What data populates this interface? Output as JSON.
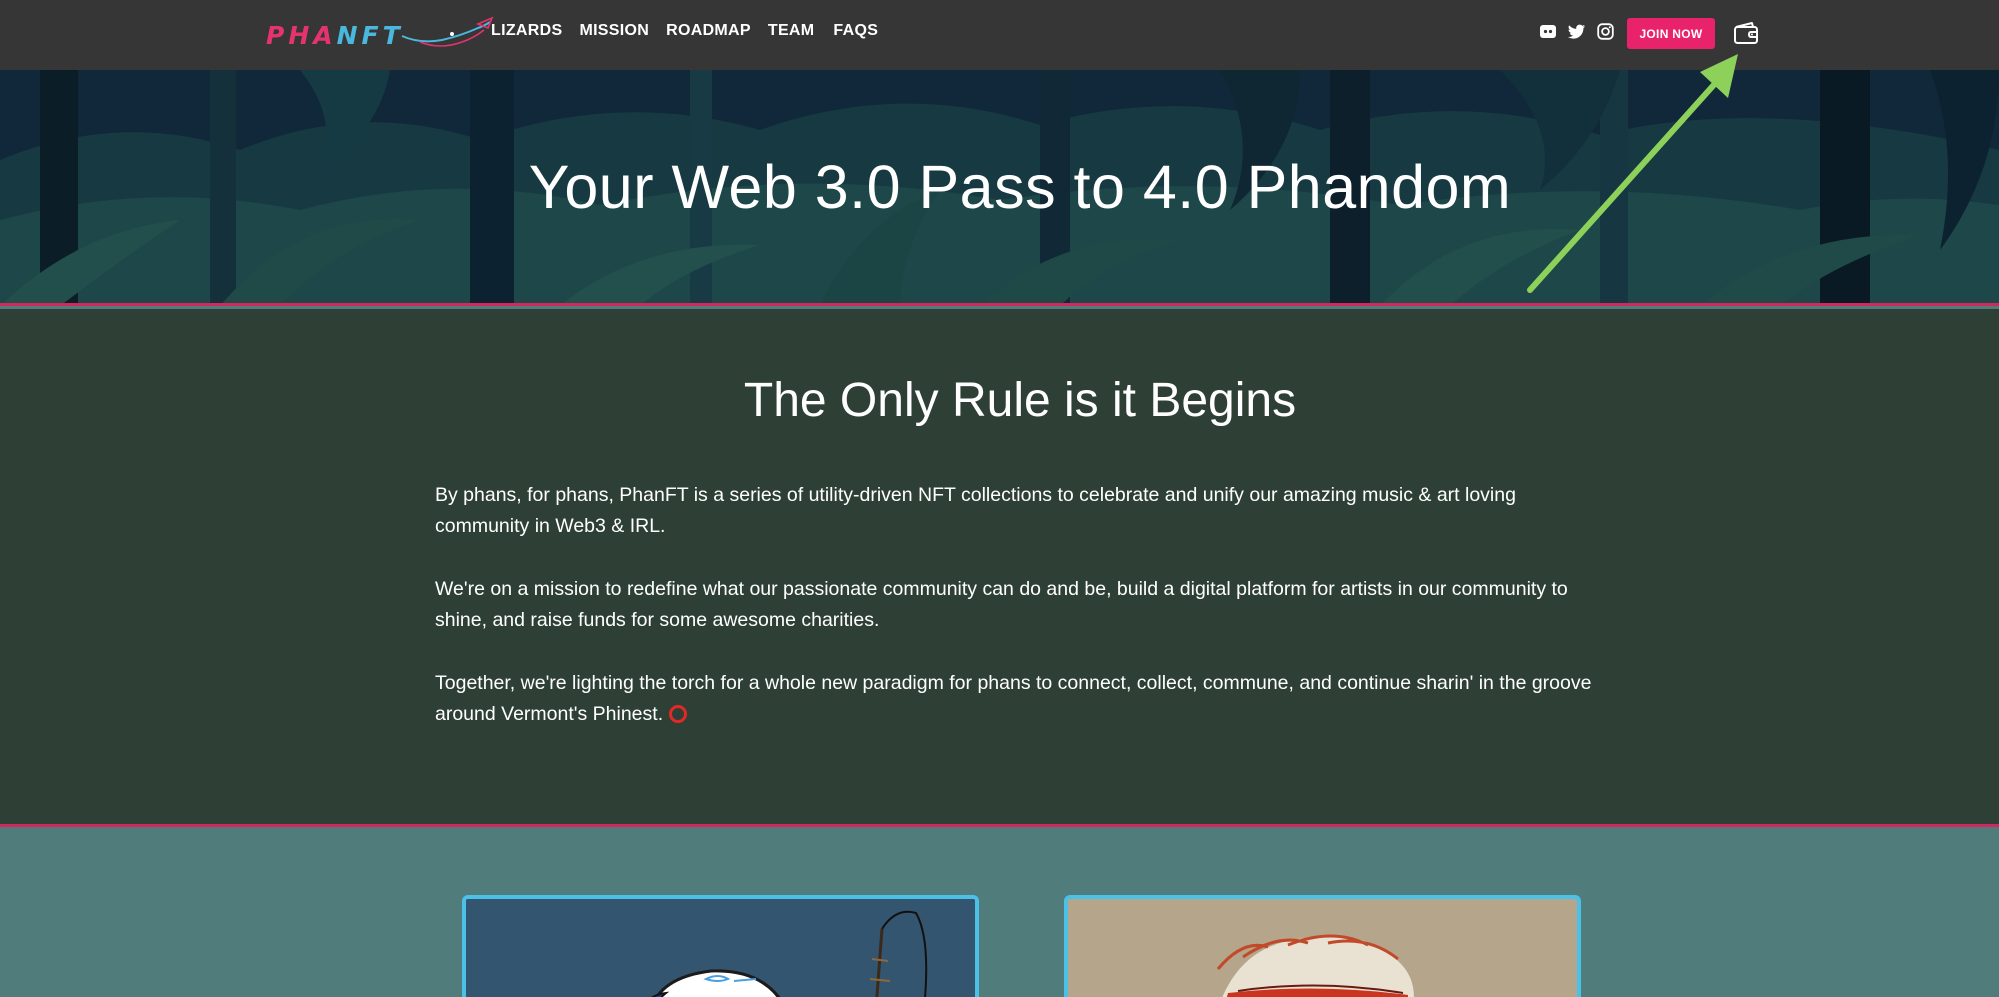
{
  "header": {
    "logo": {
      "part1": "PHA",
      "part2": "NFT"
    },
    "nav": [
      "LIZARDS",
      "MISSION",
      "ROADMAP",
      "TEAM",
      "FAQS"
    ],
    "socials": [
      "discord-icon",
      "twitter-icon",
      "instagram-icon"
    ],
    "join_label": "JOIN NOW",
    "wallet_icon": "wallet-icon"
  },
  "hero": {
    "title": "Your Web 3.0 Pass to 4.0 Phandom"
  },
  "about": {
    "title": "The Only Rule is it Begins",
    "paragraphs": [
      "By phans, for phans, PhanFT is a series of utility-driven NFT collections to celebrate and unify our amazing music & art loving community in Web3 & IRL.",
      "We're on a mission to redefine what our passionate community can do and be, build a digital platform for artists in our community to shine, and raise funds for some awesome charities.",
      "Together, we're lighting the torch for a whole new paradigm for phans to connect, collect, commune, and continue sharin' in the groove around Vermont's Phinest."
    ]
  },
  "colors": {
    "nav_bg": "#363636",
    "accent": "#e8236c",
    "about_bg": "#2e4035",
    "cards_bg": "#517c7c",
    "card_border": "#4cc1e8",
    "arrow": "#8ed15a"
  }
}
